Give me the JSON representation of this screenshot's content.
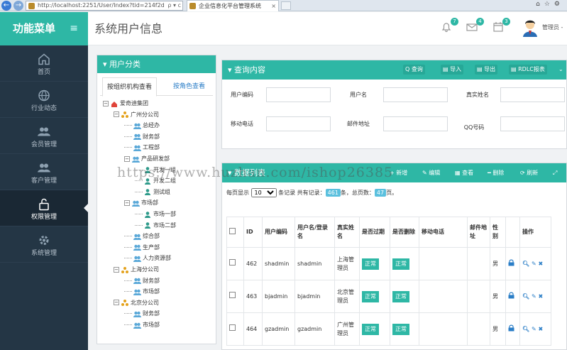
{
  "browser": {
    "url": "http://localhost:2251/User/Index?tid=214f2d",
    "url_controls": "ρ ▾ c",
    "tab_title": "企业信息化平台管理系统",
    "tab_close": "×"
  },
  "sidebar": {
    "title": "功能菜单",
    "toggle": "≡",
    "items": [
      {
        "label": "首页",
        "icon": "home-icon"
      },
      {
        "label": "行业动态",
        "icon": "globe-icon"
      },
      {
        "label": "会员管理",
        "icon": "users-icon"
      },
      {
        "label": "客户管理",
        "icon": "users-icon"
      },
      {
        "label": "权限管理",
        "icon": "lock-icon"
      },
      {
        "label": "系统管理",
        "icon": "gear-icon"
      }
    ]
  },
  "header": {
    "page_title": "系统用户信息",
    "bell_count": "7",
    "mail_count": "4",
    "task_count": "3",
    "user_label": "管理员 -"
  },
  "category_panel": {
    "title": "用户分类",
    "tab_org": "按组织机构查看",
    "tab_role": "按角色查看",
    "tree": [
      {
        "label": "爱奇迪集团",
        "icon": "home-icon"
      },
      {
        "label": "广州分公司",
        "icon": "org-icon"
      },
      {
        "label": "总经办",
        "icon": "group-icon"
      },
      {
        "label": "财务部",
        "icon": "group-icon"
      },
      {
        "label": "工程部",
        "icon": "group-icon"
      },
      {
        "label": "产品研发部",
        "icon": "group-icon"
      },
      {
        "label": "开发一组",
        "icon": "person-icon"
      },
      {
        "label": "开发二组",
        "icon": "person-icon"
      },
      {
        "label": "测试组",
        "icon": "person-icon"
      },
      {
        "label": "市场部",
        "icon": "group-icon"
      },
      {
        "label": "市场一部",
        "icon": "person-icon"
      },
      {
        "label": "市场二部",
        "icon": "person-icon"
      },
      {
        "label": "综合部",
        "icon": "group-icon"
      },
      {
        "label": "生产部",
        "icon": "group-icon"
      },
      {
        "label": "人力资源部",
        "icon": "group-icon"
      },
      {
        "label": "上海分公司",
        "icon": "org-icon"
      },
      {
        "label": "财务部",
        "icon": "group-icon"
      },
      {
        "label": "市场部",
        "icon": "group-icon"
      },
      {
        "label": "北京分公司",
        "icon": "org-icon"
      },
      {
        "label": "财务部",
        "icon": "group-icon"
      },
      {
        "label": "市场部",
        "icon": "group-icon"
      }
    ]
  },
  "query_panel": {
    "title": "查询内容",
    "buttons": {
      "query": "查询",
      "import": "导入",
      "export": "导出",
      "report": "RDLC报表"
    },
    "labels": {
      "user_code": "用户编码",
      "username": "用户名",
      "real_name": "真实姓名",
      "mobile": "移动电话",
      "email": "邮件地址",
      "qq": "QQ号码"
    }
  },
  "data_panel": {
    "title": "数据列表",
    "buttons": {
      "add": "新增",
      "edit": "编辑",
      "view": "查看",
      "delete": "删除",
      "refresh": "刷新"
    },
    "pager": {
      "prefix": "每页显示",
      "page_size": "10",
      "unit": "条记录",
      "total_label": "共有记录：",
      "total": "461",
      "pages_label": "条，总页数：",
      "pages": "47",
      "pages_unit": "页。"
    },
    "columns": [
      "ID",
      "用户编码",
      "用户名/登录名",
      "真实姓名",
      "是否过期",
      "是否删除",
      "移动电话",
      "邮件地址",
      "性别",
      "",
      "操作"
    ],
    "rows": [
      {
        "id": "462",
        "code": "shadmin",
        "login": "shadmin",
        "real_name": "上海管理员",
        "expired": "正常",
        "deleted": "正常",
        "mobile": "",
        "email": "",
        "gender": "男"
      },
      {
        "id": "463",
        "code": "bjadmin",
        "login": "bjadmin",
        "real_name": "北京管理员",
        "expired": "正常",
        "deleted": "正常",
        "mobile": "",
        "email": "",
        "gender": "男"
      },
      {
        "id": "464",
        "code": "gzadmin",
        "login": "gzadmin",
        "real_name": "广州管理员",
        "expired": "正常",
        "deleted": "正常",
        "mobile": "",
        "email": "",
        "gender": "男"
      }
    ]
  },
  "watermark": "https://www.huzhan.com/ishop26385",
  "colors": {
    "accent": "#2eb7a5",
    "sidebar": "#243645",
    "link": "#2b7ec7"
  }
}
